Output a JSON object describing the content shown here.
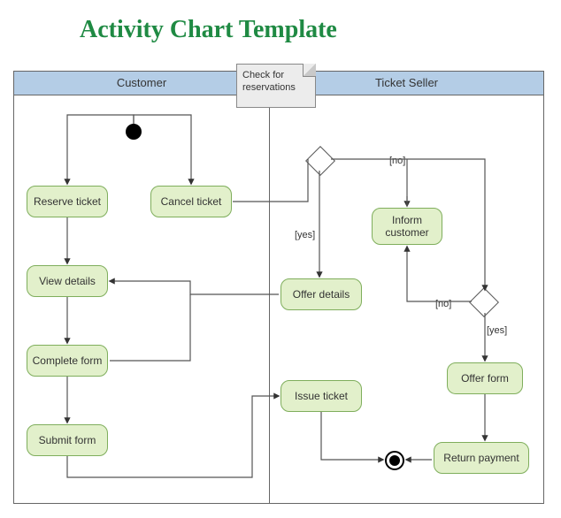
{
  "title": "Activity Chart Template",
  "lanes": {
    "customer": "Customer",
    "seller": "Ticket Seller"
  },
  "note": "Check for reservations",
  "activities": {
    "reserve": "Reserve ticket",
    "cancel": "Cancel ticket",
    "view": "View details",
    "complete": "Complete form",
    "submit": "Submit form",
    "offerdet": "Offer details",
    "issue": "Issue ticket",
    "inform": "Inform customer",
    "offerform": "Offer form",
    "return": "Return payment"
  },
  "labels": {
    "yes1": "[yes]",
    "no1": "[no]",
    "yes2": "[yes]",
    "no2": "[no]"
  }
}
